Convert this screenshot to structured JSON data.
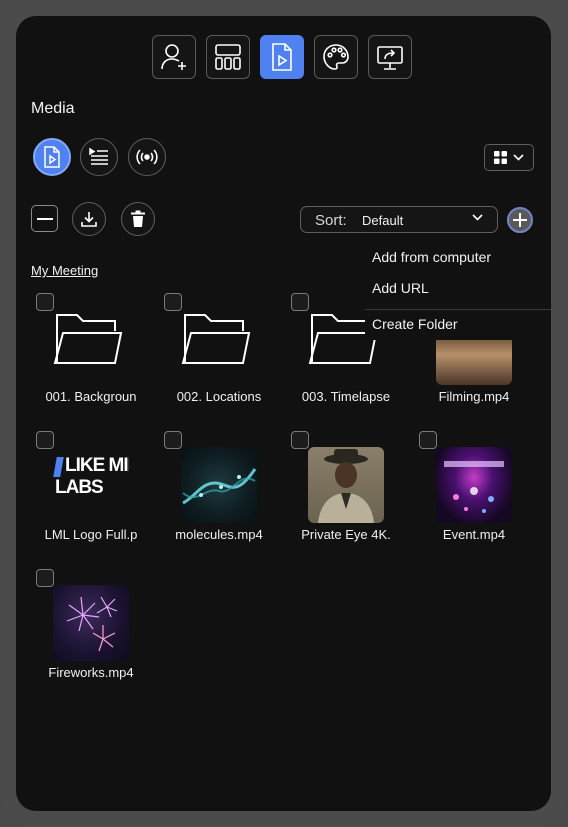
{
  "page_title": "Media",
  "topnav": {
    "items": [
      {
        "icon": "user-add-icon",
        "active": false
      },
      {
        "icon": "layout-icon",
        "active": false
      },
      {
        "icon": "media-icon",
        "active": true
      },
      {
        "icon": "palette-icon",
        "active": false
      },
      {
        "icon": "share-screen-icon",
        "active": false
      }
    ]
  },
  "media_tabs": [
    {
      "icon": "media-file-icon",
      "active": true
    },
    {
      "icon": "playlist-icon",
      "active": false
    },
    {
      "icon": "broadcast-icon",
      "active": false
    }
  ],
  "view_toggle": {
    "icon": "grid-icon"
  },
  "sort": {
    "label": "Sort:",
    "value": "Default"
  },
  "breadcrumb": "My Meeting",
  "context_menu": {
    "items": [
      "Add from computer",
      "Add URL",
      "Create Folder"
    ]
  },
  "items": [
    {
      "name": "001. Backgroun",
      "kind": "folder"
    },
    {
      "name": "002. Locations",
      "kind": "folder"
    },
    {
      "name": "003. Timelapse",
      "kind": "folder"
    },
    {
      "name": "Filming.mp4",
      "kind": "video"
    },
    {
      "name": "LML Logo Full.p",
      "kind": "image",
      "logo_text": [
        "LIKE MIN",
        "LABS"
      ]
    },
    {
      "name": "molecules.mp4",
      "kind": "video"
    },
    {
      "name": "Private Eye 4K.",
      "kind": "video"
    },
    {
      "name": "Event.mp4",
      "kind": "video"
    },
    {
      "name": "Fireworks.mp4",
      "kind": "video"
    }
  ],
  "colors": {
    "accent": "#4f82f0",
    "background": "#111111",
    "frame": "#4b4b4b"
  }
}
